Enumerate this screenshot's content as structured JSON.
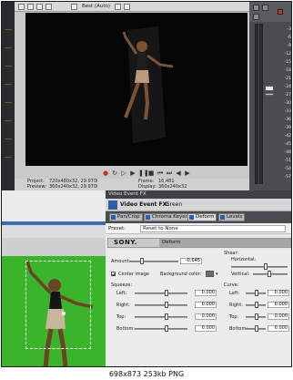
{
  "preview": {
    "quality_label": "Best (Auto)",
    "project_label": "Project:",
    "project_value": "720x480x32, 29.970i",
    "preview_label": "Preview:",
    "preview_value": "360x240x32, 29.970i",
    "frame_label": "Frame:",
    "frame_value": "16,481",
    "display_label": "Display:",
    "display_value": "360x240x32"
  },
  "meter": {
    "scale": [
      "3",
      "6",
      "9",
      "12",
      "15",
      "18",
      "21",
      "24",
      "27",
      "30",
      "33",
      "36",
      "39",
      "42",
      "45",
      "48",
      "51",
      "54",
      "57"
    ]
  },
  "fx": {
    "window_title": "Video Event FX",
    "header_label": "Video Event FX:",
    "header_value": "Green",
    "chain": [
      {
        "label": "Pan/Crop",
        "active": false
      },
      {
        "label": "Chroma Keyer",
        "active": false
      },
      {
        "label": "Deform",
        "active": true
      },
      {
        "label": "Levels",
        "active": false
      }
    ],
    "preset_label": "Preset:",
    "preset_value": "Reset to None",
    "brand": "SONY.",
    "plugin_name": "Deform",
    "amount_label": "Amount:",
    "amount_value": "-0.645",
    "center_image_label": "Center image",
    "center_image_checked": true,
    "background_color_label": "Background color:",
    "shear_label": "Shear:",
    "horizontal_label": "Horizontal:",
    "vertical_label": "Vertical:",
    "squeeze_label": "Squeeze:",
    "curve_label": "Curve:",
    "left_label": "Left:",
    "right_label": "Right:",
    "top_label": "Top:",
    "bottom_label": "Bottom:",
    "squeeze_left": "0.000",
    "squeeze_right": "0.000",
    "squeeze_top": "0.000",
    "squeeze_bottom": "0.000",
    "curve_left": "0.000",
    "curve_right": "0.000",
    "curve_top": "0.000",
    "curve_bottom": "0.000"
  },
  "caption": "698x873  253kb  PNG"
}
